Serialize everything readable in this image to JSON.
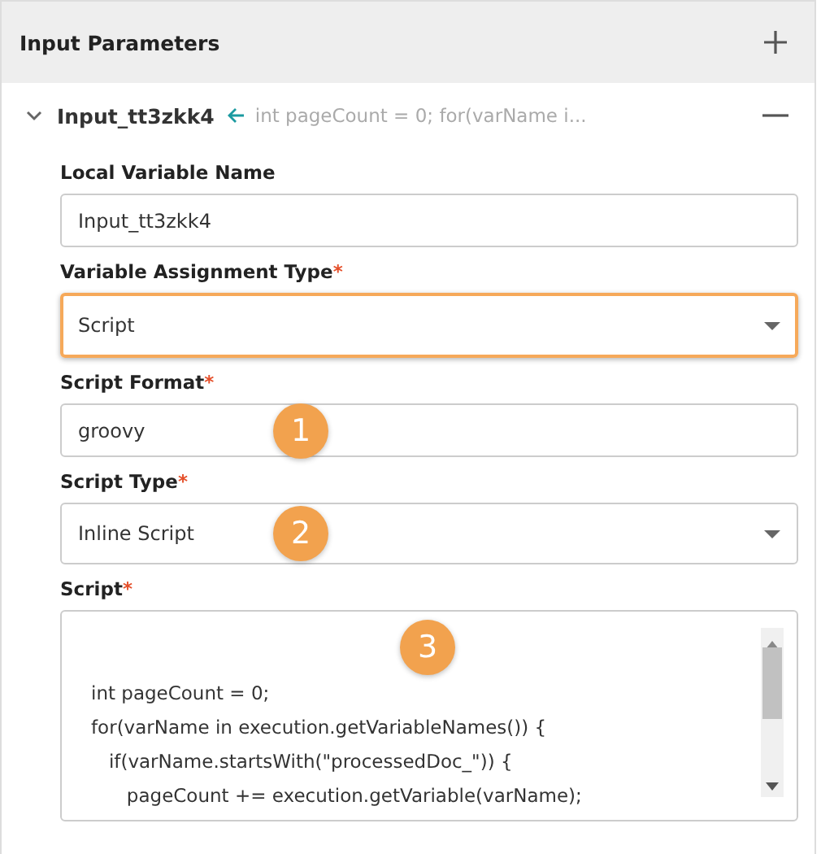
{
  "panel": {
    "title": "Input Parameters"
  },
  "parameter": {
    "name": "Input_tt3zkk4",
    "expanded": true,
    "preview": "int pageCount = 0; for(varName i..."
  },
  "fields": [
    {
      "kind": "text",
      "label": "Local Variable Name",
      "value": "Input_tt3zkk4",
      "focused": false
    },
    {
      "kind": "select",
      "label": "Variable Assignment Type",
      "required_mark": "*",
      "value": "Script",
      "focused": true
    },
    {
      "kind": "text",
      "label": "Script Format",
      "required_mark": "*",
      "value": "groovy",
      "focused": false,
      "badge": "1"
    },
    {
      "kind": "select",
      "label": "Script Type",
      "required_mark": "*",
      "value": "Inline Script",
      "focused": false,
      "badge": "2"
    },
    {
      "kind": "code",
      "label": "Script",
      "required_mark": "*",
      "value": "int pageCount = 0;\nfor(varName in execution.getVariableNames()) {\n   if(varName.startsWith(\"processedDoc_\")) {\n      pageCount += execution.getVariable(varName);",
      "focused": false,
      "badge": "3"
    }
  ]
}
